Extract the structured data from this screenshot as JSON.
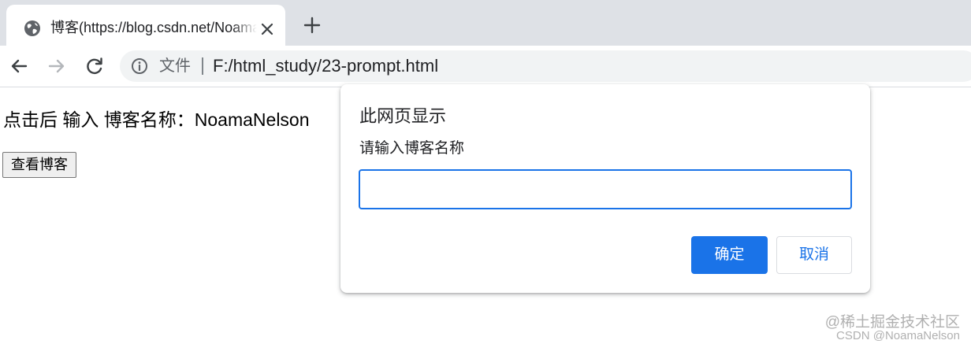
{
  "browser": {
    "tab": {
      "title": "博客(https://blog.csdn.net/NoamaNelson)",
      "favicon": "globe-icon"
    },
    "new_tab_icon": "plus-icon",
    "toolbar": {
      "back_icon": "back-arrow-icon",
      "forward_icon": "forward-arrow-icon",
      "reload_icon": "reload-icon"
    },
    "omnibox": {
      "info_icon": "info-icon",
      "scheme_label": "文件",
      "url": "F:/html_study/23-prompt.html"
    }
  },
  "page": {
    "result_text": "点击后 输入 博客名称：NoamaNelson",
    "button_label": "查看博客"
  },
  "dialog": {
    "title": "此网页显示",
    "message": "请输入博客名称",
    "input_value": "",
    "ok_label": "确定",
    "cancel_label": "取消"
  },
  "watermark": {
    "line1": "@稀土掘金技术社区",
    "line2": "CSDN @NoamaNelson"
  },
  "colors": {
    "tab_strip": "#dee1e6",
    "omnibox": "#f1f3f4",
    "accent": "#1a73e8"
  }
}
